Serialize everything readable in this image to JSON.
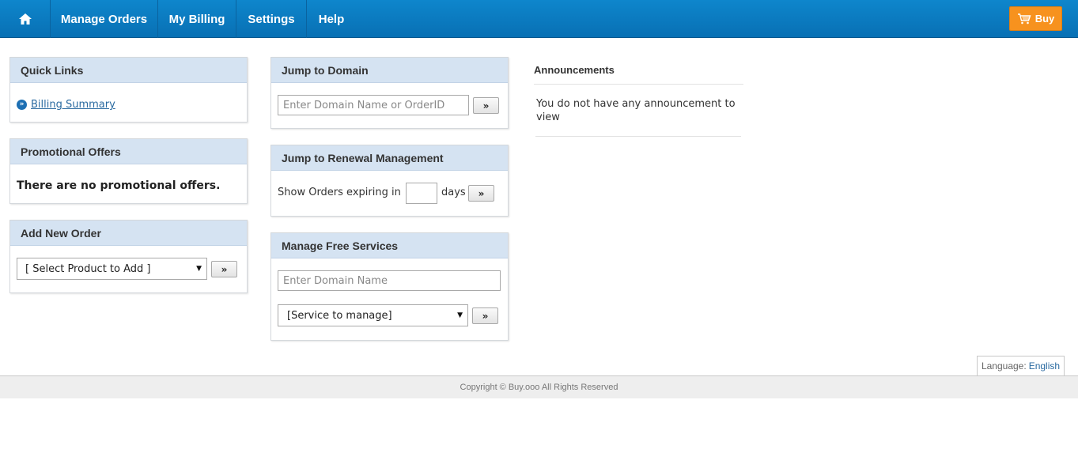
{
  "nav": {
    "home_icon": "home-icon",
    "items": [
      "Manage Orders",
      "My Billing",
      "Settings",
      "Help"
    ],
    "buy_label": "Buy",
    "buy_icon": "cart-icon",
    "color": "#0a7bc1",
    "buy_color": "#f7921e"
  },
  "quick_links": {
    "title": "Quick Links",
    "link": "Billing Summary",
    "icon": "double-chevron-icon"
  },
  "promo": {
    "title": "Promotional Offers",
    "text": "There are no promotional offers."
  },
  "new_order": {
    "title": "Add New Order",
    "select_value": "[ Select Product to Add ]",
    "button": "»"
  },
  "jump_domain": {
    "title": "Jump to Domain",
    "placeholder": "Enter Domain Name or OrderID",
    "button": "»"
  },
  "renewal": {
    "title": "Jump to Renewal Management",
    "label_before": "Show Orders expiring in",
    "label_after": "days",
    "days_value": "",
    "button": "»"
  },
  "free_services": {
    "title": "Manage Free Services",
    "placeholder": "Enter Domain Name",
    "select_value": "[Service to manage]",
    "button": "»"
  },
  "announcements": {
    "title": "Announcements",
    "text": "You do not have any announcement to view"
  },
  "footer": {
    "language_label": "Language:",
    "language_value": "English",
    "copyright": "Copyright © Buy.ooo All Rights Reserved"
  }
}
